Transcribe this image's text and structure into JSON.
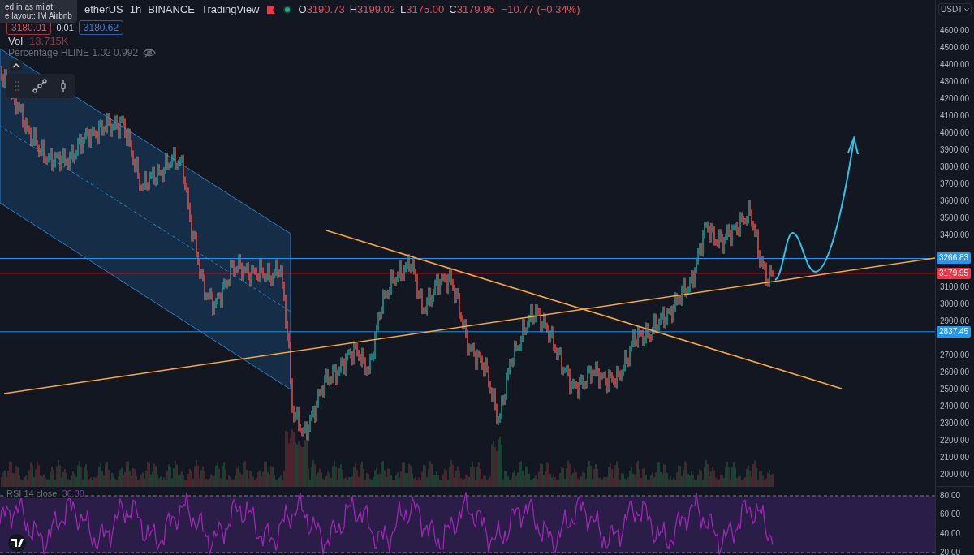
{
  "tooltip": {
    "lines": [
      "ed in as mijat",
      "e layout: IM Airbnb"
    ]
  },
  "header": {
    "symbol": "etherUS",
    "interval": "1h",
    "exchange": "BINANCE",
    "source": "TradingView",
    "market_open": true,
    "ohlc": [
      {
        "label": "O",
        "value": "3190.73"
      },
      {
        "label": "H",
        "value": "3199.02"
      },
      {
        "label": "L",
        "value": "3175.00"
      },
      {
        "label": "C",
        "value": "3179.95"
      }
    ],
    "change": "−10.77 (−0.34%)"
  },
  "quote": {
    "sell": "3180.01",
    "spread": "0.01",
    "buy": "3180.62"
  },
  "volume": {
    "label": "Vol",
    "value": "13.715K"
  },
  "indicator": {
    "name": "Percentage HLINE 1.02 0.992",
    "hidden": true
  },
  "currency": "USDT",
  "price_axis": [
    "4600.00",
    "4500.00",
    "4400.00",
    "4300.00",
    "4200.00",
    "4100.00",
    "4000.00",
    "3900.00",
    "3800.00",
    "3700.00",
    "3600.00",
    "3500.00",
    "3400.00",
    "3100.00",
    "3000.00",
    "2900.00",
    "2700.00",
    "2600.00",
    "2500.00",
    "2400.00",
    "2300.00",
    "2200.00",
    "2100.00",
    "2000.00"
  ],
  "price_labels": [
    {
      "value": "3266.83",
      "color": "#2196f3"
    },
    {
      "value": "3179.95",
      "color": "#f23645"
    },
    {
      "value": "2837.45",
      "color": "#2196f3"
    }
  ],
  "rsi": {
    "name": "RSI 14 close",
    "value": "36.30",
    "axis": [
      "80.00",
      "60.00",
      "40.00",
      "20.00"
    ]
  }
}
